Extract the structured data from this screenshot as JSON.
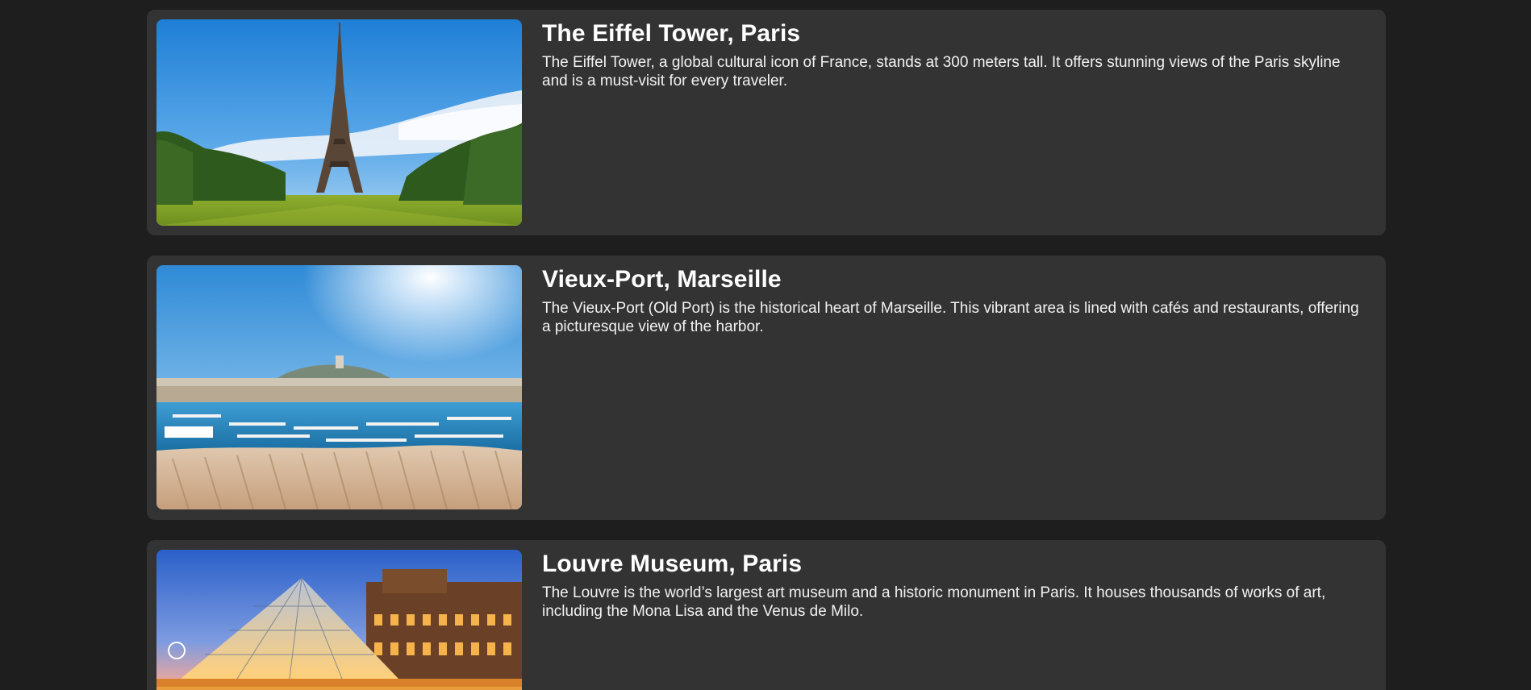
{
  "destinations": [
    {
      "title": "The Eiffel Tower, Paris",
      "description": "The Eiffel Tower, a global cultural icon of France, stands at 300 meters tall. It offers stunning views of the Paris skyline and is a must-visit for every traveler."
    },
    {
      "title": "Vieux-Port, Marseille",
      "description": "The Vieux-Port (Old Port) is the historical heart of Marseille. This vibrant area is lined with cafés and restaurants, offering a picturesque view of the harbor."
    },
    {
      "title": "Louvre Museum, Paris",
      "description": "The Louvre is the world’s largest art museum and a historic monument in Paris. It houses thousands of works of art, including the Mona Lisa and the Venus de Milo."
    }
  ]
}
